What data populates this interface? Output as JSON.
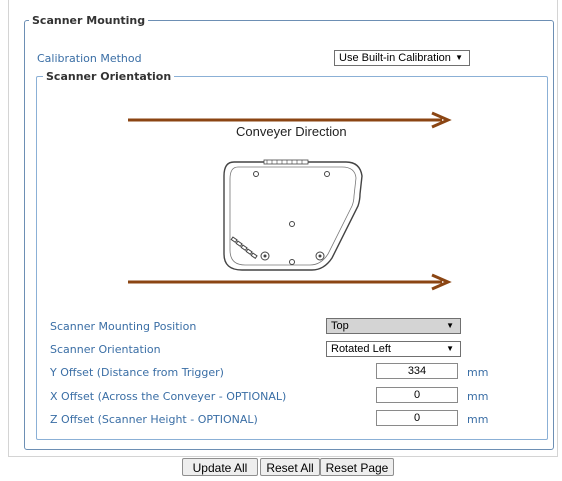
{
  "scanner_mounting": {
    "legend": "Scanner Mounting",
    "calibration_method_label": "Calibration Method",
    "calibration_method_value": "Use Built-in Calibration"
  },
  "scanner_orientation": {
    "legend": "Scanner Orientation",
    "conveyer_direction": "Conveyer Direction"
  },
  "fields": {
    "mounting_position_label": "Scanner Mounting Position",
    "mounting_position_value": "Top",
    "orientation_label": "Scanner Orientation",
    "orientation_value": "Rotated Left",
    "y_offset_label": "Y Offset (Distance from Trigger)",
    "y_offset_value": "334",
    "x_offset_label": "X Offset (Across the Conveyer - OPTIONAL)",
    "x_offset_value": "0",
    "z_offset_label": "Z Offset (Scanner Height - OPTIONAL)",
    "z_offset_value": "0",
    "unit": "mm"
  },
  "buttons": {
    "update_all": "Update All",
    "reset_all": "Reset All",
    "reset_page": "Reset Page"
  },
  "colors": {
    "arrow": "#8b4513",
    "label": "#3a6ea5",
    "fieldset_border": "#8bb0d6"
  }
}
